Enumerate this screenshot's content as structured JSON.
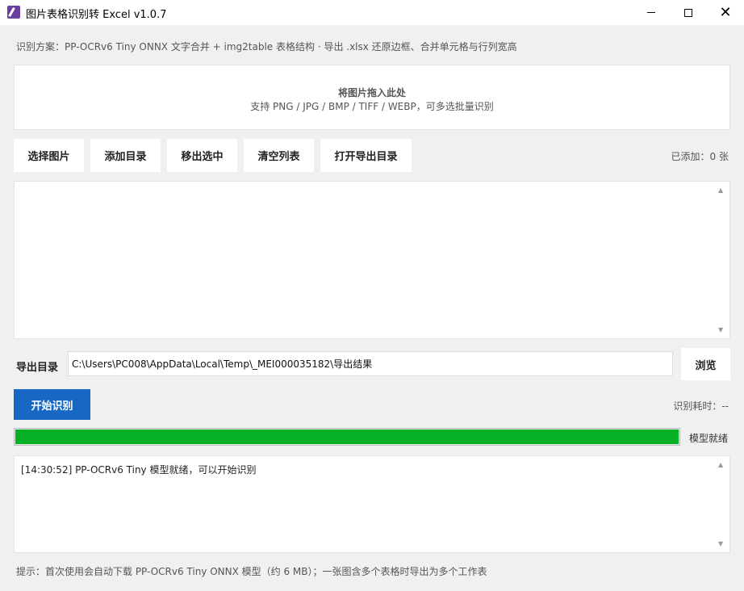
{
  "window": {
    "title": "图片表格识别转 Excel v1.0.7",
    "min_glyph": "–",
    "close_glyph": "✕"
  },
  "scheme_text": "识别方案：PP-OCRv6 Tiny ONNX 文字合并 + img2table 表格结构 · 导出 .xlsx 还原边框、合并单元格与行列宽高",
  "dropzone": {
    "title": "将图片拖入此处",
    "subtitle": "支持 PNG / JPG / BMP / TIFF / WEBP，可多选批量识别"
  },
  "toolbar": {
    "select_images": "选择图片",
    "add_folder": "添加目录",
    "remove_selected": "移出选中",
    "clear_list": "清空列表",
    "open_export_dir": "打开导出目录",
    "added_count": "已添加：0 张"
  },
  "export": {
    "label": "导出目录",
    "path": "C:\\Users\\PC008\\AppData\\Local\\Temp\\_MEI000035182\\导出结果",
    "browse": "浏览"
  },
  "run": {
    "start": "开始识别",
    "elapsed": "识别耗时：--"
  },
  "progress": {
    "percent": 100,
    "status": "模型就绪"
  },
  "log": {
    "lines": [
      "[14:30:52] PP-OCRv6 Tiny 模型就绪，可以开始识别"
    ]
  },
  "hint": "提示：首次使用会自动下载 PP-OCRv6 Tiny ONNX 模型（约 6 MB）；一张图含多个表格时导出为多个工作表",
  "scroll": {
    "up": "▲",
    "down": "▼"
  },
  "colors": {
    "accent": "#1668c4",
    "progress": "#06b025"
  }
}
